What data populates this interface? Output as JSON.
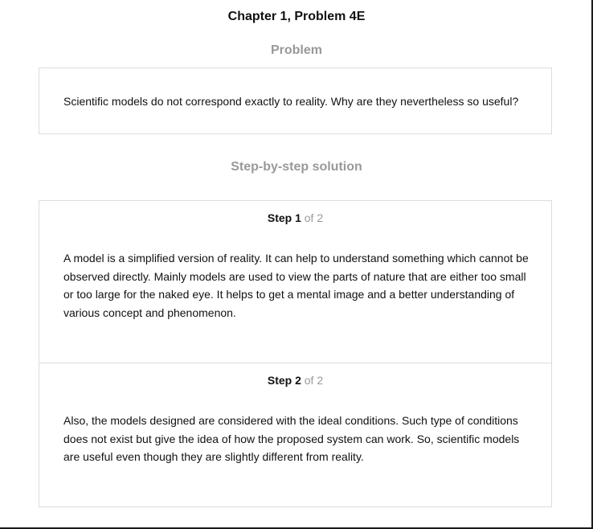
{
  "page": {
    "title": "Chapter 1, Problem 4E",
    "problem_heading": "Problem",
    "problem_text": "Scientific models do not correspond exactly to reality. Why are they nevertheless so useful?",
    "solution_heading": "Step-by-step solution"
  },
  "steps": [
    {
      "label": "Step 1",
      "of_label": "of 2",
      "text": "A model is a simplified version of reality. It can help to understand something which cannot be observed directly. Mainly models are used to view the parts of nature that are either too small or too large for the naked eye. It helps to get a mental image and a better understanding of various concept and phenomenon."
    },
    {
      "label": "Step 2",
      "of_label": "of 2",
      "text": "Also, the models designed are considered with the ideal conditions. Such type of conditions does not exist but give the idea of how the proposed system can work. So, scientific models are useful even though they are slightly different from reality."
    }
  ],
  "colors": {
    "heading_muted": "#999999",
    "border": "#dddddd",
    "text": "#111111"
  }
}
